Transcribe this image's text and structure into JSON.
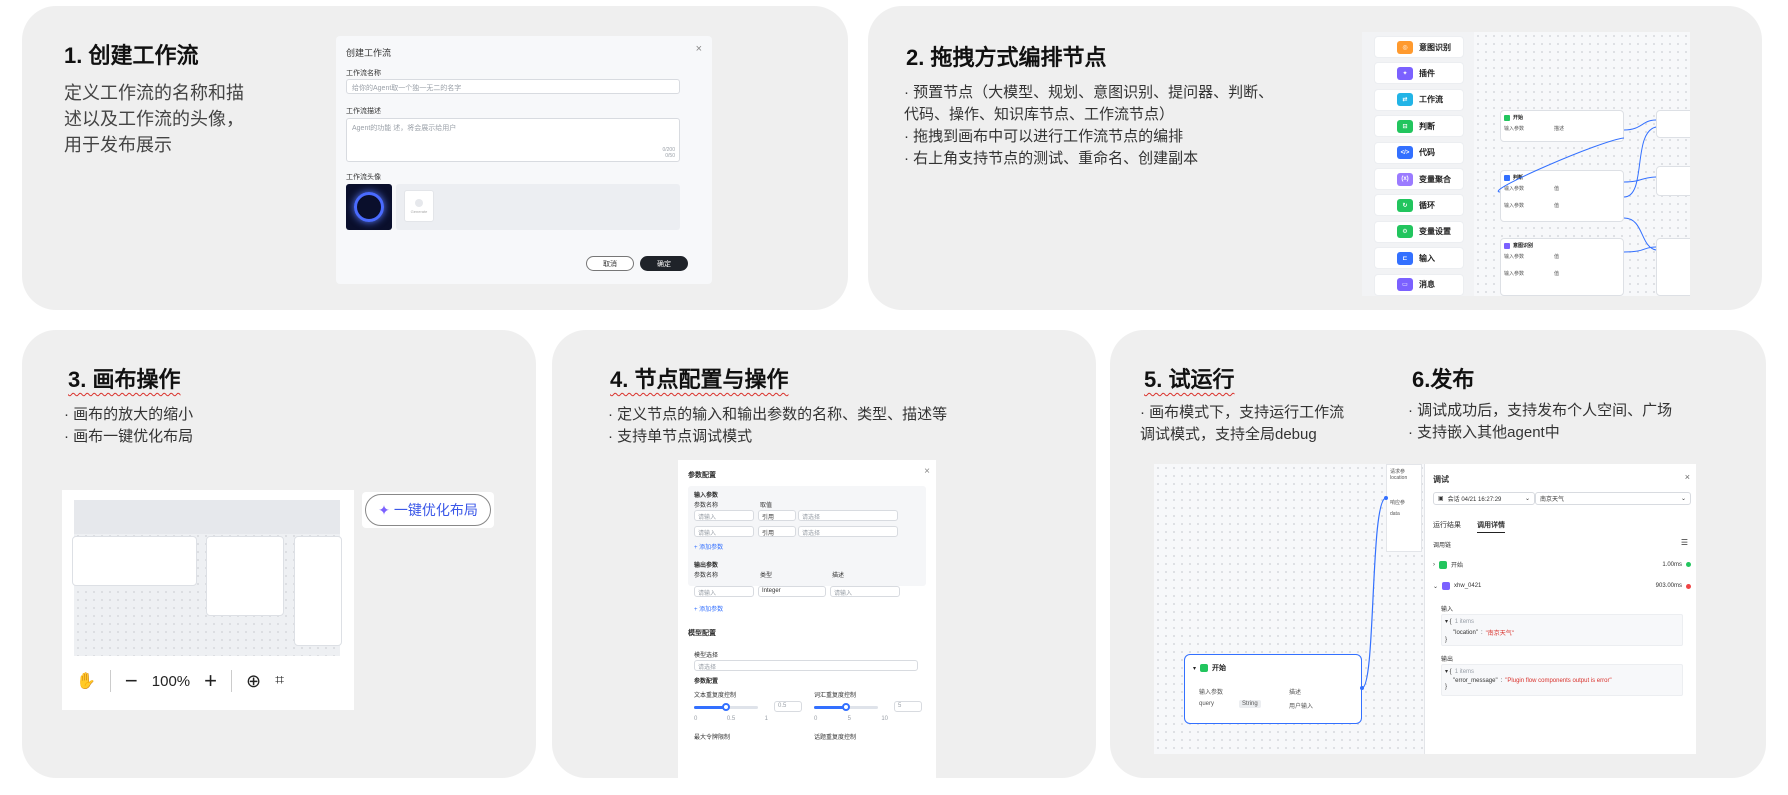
{
  "cards": {
    "c1": {
      "title": "1. 创建工作流",
      "desc": [
        "定义工作流的名称和描",
        "述以及工作流的头像，",
        "用于发布展示"
      ],
      "dialog": {
        "title": "创建工作流",
        "name_label": "工作流名称",
        "name_placeholder": "给你的Agent取一个独一无二的名字",
        "desc_label": "工作流描述",
        "desc_placeholder": "Agent的功能 述，将会展示给用户",
        "counter": "0/200",
        "counter2": "0/50",
        "avatar_label": "工作流头像",
        "generate_label": "Generate",
        "cancel": "取消",
        "confirm": "确定"
      }
    },
    "c2": {
      "title": "2. 拖拽方式编排节点",
      "desc": [
        "· 预置节点（大模型、规划、意图识别、提问器、判断、",
        "代码、操作、知识库节点、工作流节点）",
        "· 拖拽到画布中可以进行工作流节点的编排",
        "· 右上角支持节点的测试、重命名、创建副本"
      ],
      "sidebar": [
        "意图识别",
        "插件",
        "工作流",
        "判断",
        "代码",
        "变量聚合",
        "循环",
        "变量设置",
        "输入",
        "消息"
      ],
      "sidebar_icons": [
        "intent-icon",
        "plugin-icon",
        "workflow-icon",
        "condition-icon",
        "code-icon",
        "aggregate-icon",
        "loop-icon",
        "variable-icon",
        "input-icon",
        "message-icon"
      ],
      "sidebar_colors": [
        "#ff9a2e",
        "#7b61ff",
        "#22b4e6",
        "#22c55e",
        "#3370ff",
        "#9b7bff",
        "#22c55e",
        "#22c55e",
        "#3370ff",
        "#7b61ff"
      ],
      "nodes": [
        "开始",
        "判断",
        "意图识别"
      ]
    },
    "c3": {
      "title": "3. 画布操作",
      "desc": [
        "· 画布的放大的缩小",
        "· 画布一键优化布局"
      ],
      "zoom": "100%",
      "optimize_label": "一键优化布局"
    },
    "c4": {
      "title": "4. 节点配置与操作",
      "desc": [
        "· 定义节点的输入和输出参数的名称、类型、描述等",
        "· 支持单节点调试模式"
      ],
      "panel": {
        "title": "参数配置",
        "input_params": "输入参数",
        "param_name": "参数名称",
        "value": "取值",
        "input_ph": "请输入",
        "ref": "引用",
        "select_ph": "请选择",
        "add_param": "+ 添加参数",
        "output_params": "输出参数",
        "type": "类型",
        "description": "描述",
        "type_value": "Integer",
        "model_config": "模型配置",
        "model_select": "模型选择",
        "param_config": "参数配置",
        "slider1_label": "文本重复度控制",
        "slider2_label": "词汇重复度控制",
        "slider1_value": "0.5",
        "slider2_value": "5",
        "slider1_ticks": [
          "0",
          "0.5",
          "1"
        ],
        "slider2_ticks": [
          "0",
          "5",
          "10"
        ],
        "max_token": "最大令牌限制",
        "topic_repeat": "话题重复度控制"
      }
    },
    "c5": {
      "title": "5. 试运行",
      "desc": [
        "· 画布模式下，支持运行工作流",
        "调试模式，支持全局debug"
      ],
      "start_node": {
        "title": "开始",
        "input_params": "输入参数",
        "description": "描述",
        "param": "query",
        "type": "String",
        "desc_val": "用户输入"
      },
      "side_node": {
        "l1": "请求参",
        "l2": "location",
        "l3": "响应参",
        "l4": "data"
      },
      "debug": {
        "title": "调试",
        "session": "会话 04/21 16:27:29",
        "query": "南京天气",
        "tab1": "运行结果",
        "tab2": "调用详情",
        "chain": "调用链",
        "step1": "开始",
        "step1_time": "1.00ms",
        "step2": "xhw_0421",
        "step2_time": "903.00ms",
        "input_label": "输入",
        "input_items": "1 items",
        "input_key": "\"location\"",
        "input_val": "\"南京天气\"",
        "output_label": "输出",
        "output_items": "1 items",
        "output_key": "\"error_message\"",
        "output_val": "\"Plugin flow components output is error\""
      }
    },
    "c6": {
      "title": "6.发布",
      "desc": [
        "· 调试成功后，支持发布个人空间、广场",
        "· 支持嵌入其他agent中"
      ]
    }
  }
}
